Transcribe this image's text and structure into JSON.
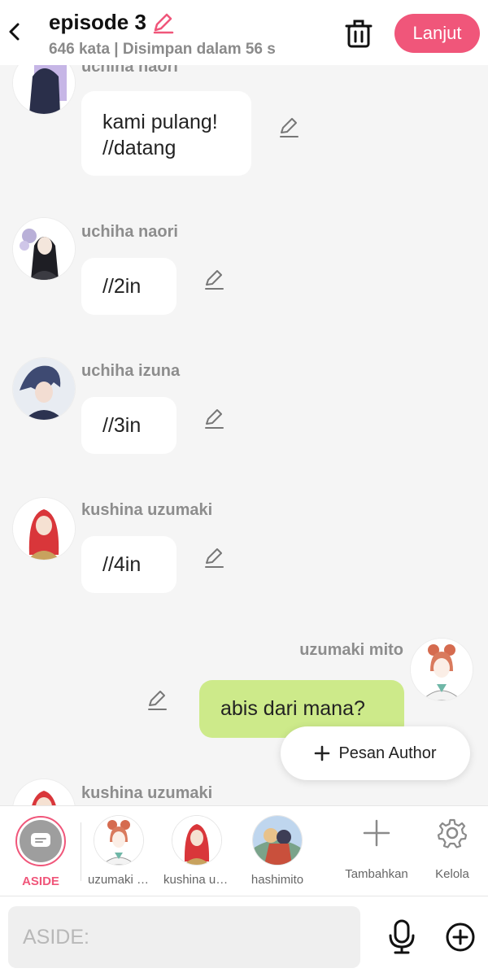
{
  "header": {
    "title": "episode 3",
    "subtitle": "646 kata | Disimpan dalam 56 s",
    "next_label": "Lanjut"
  },
  "messages": [
    {
      "name": "uchiha naori",
      "text_lines": [
        "kami pulang!",
        "//datang"
      ],
      "side": "left"
    },
    {
      "name": "uchiha naori",
      "text": "//2in",
      "side": "left"
    },
    {
      "name": "uchiha izuna",
      "text": "//3in",
      "side": "left"
    },
    {
      "name": "kushina uzumaki",
      "text": "//4in",
      "side": "left"
    },
    {
      "name": "uzumaki mito",
      "text": "abis dari mana?",
      "side": "right"
    },
    {
      "name": "kushina uzumaki",
      "side": "left"
    }
  ],
  "floating": {
    "pesan_author": "Pesan Author"
  },
  "characters": [
    {
      "label": "ASIDE"
    },
    {
      "label": "uzumaki mito"
    },
    {
      "label": "kushina uzumaki"
    },
    {
      "label": "hashimito"
    },
    {
      "label": "Tambahkan"
    },
    {
      "label": "Kelola"
    }
  ],
  "input": {
    "placeholder": "ASIDE:"
  },
  "colors": {
    "accent": "#f0567a",
    "green_bubble": "#cdea8a",
    "background": "#f5f5f5"
  }
}
